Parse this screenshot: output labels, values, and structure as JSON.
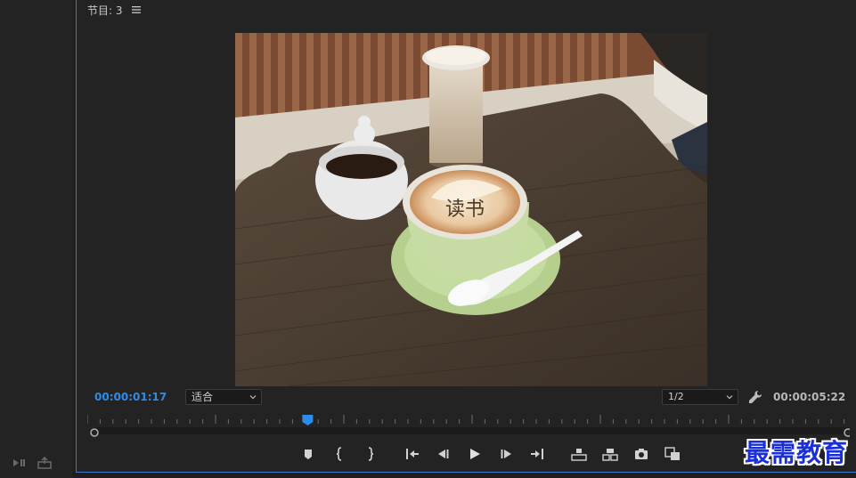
{
  "panel": {
    "title": "节目: 3"
  },
  "monitor": {
    "current_timecode": "00:00:01:17",
    "duration_timecode": "00:00:05:22",
    "zoom_level": "适合",
    "playback_resolution": "1/2",
    "playhead_fraction": 0.285
  },
  "frame_image": {
    "cup_text": "读书"
  },
  "transport": {
    "buttons": [
      {
        "name": "add-marker",
        "icon": "marker-icon"
      },
      {
        "name": "mark-in",
        "icon": "mark-in-icon"
      },
      {
        "name": "mark-out",
        "icon": "mark-out-icon"
      },
      {
        "name": "go-to-in",
        "icon": "go-to-in-icon"
      },
      {
        "name": "step-back",
        "icon": "step-back-icon"
      },
      {
        "name": "play",
        "icon": "play-icon"
      },
      {
        "name": "step-forward",
        "icon": "step-forward-icon"
      },
      {
        "name": "go-to-out",
        "icon": "go-to-out-icon"
      },
      {
        "name": "lift",
        "icon": "lift-icon"
      },
      {
        "name": "extract",
        "icon": "extract-icon"
      },
      {
        "name": "export-frame",
        "icon": "camera-icon"
      },
      {
        "name": "comparison-view",
        "icon": "comparison-icon"
      }
    ]
  },
  "watermark": {
    "text": "最需教育"
  },
  "colors": {
    "accent_blue": "#2d8ceb",
    "panel_bg": "#232323",
    "watermark_blue": "#1b2fd9"
  }
}
